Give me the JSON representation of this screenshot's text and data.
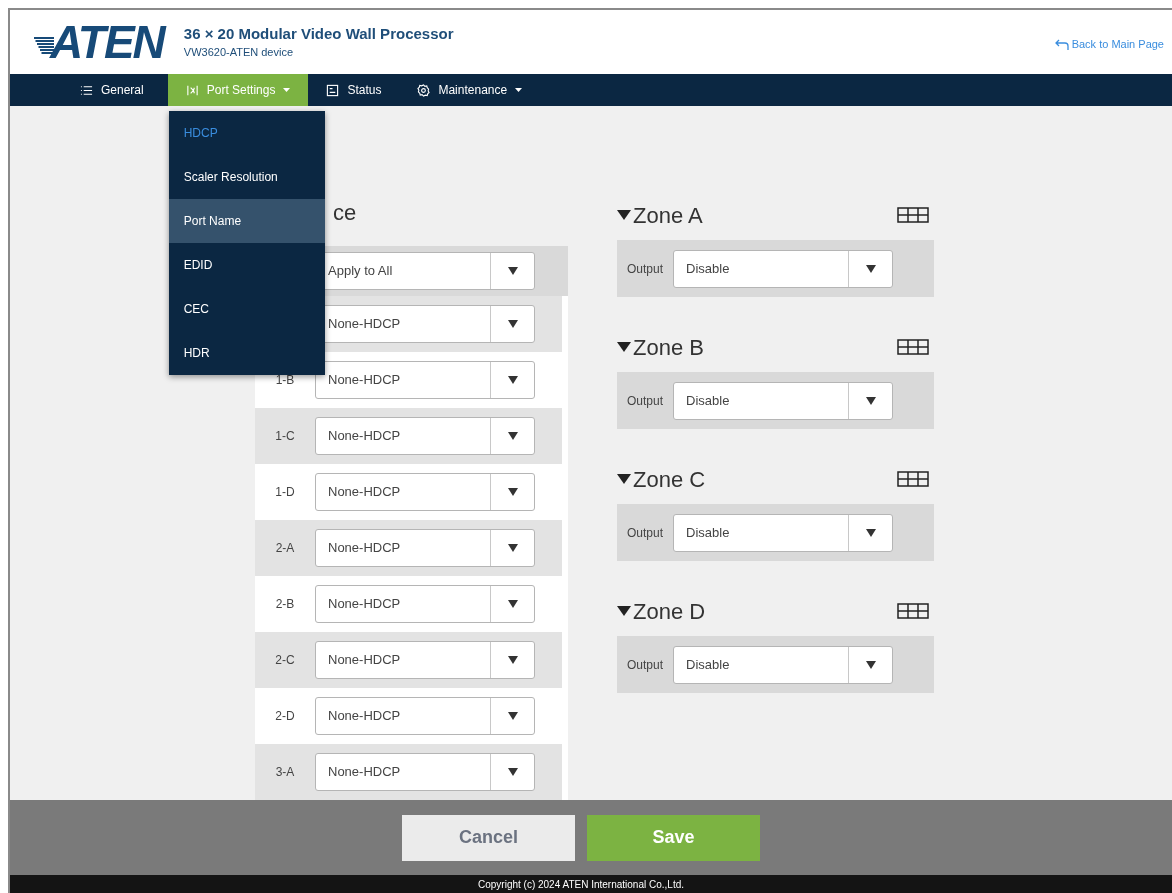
{
  "header": {
    "logo": "ATEN",
    "title": "36 × 20 Modular Video Wall Processor",
    "subtitle": "VW3620-ATEN device",
    "back_link": "Back to Main Page"
  },
  "nav": [
    {
      "label": "General",
      "selected": false,
      "dropdown": false
    },
    {
      "label": "Port Settings",
      "selected": true,
      "dropdown": true
    },
    {
      "label": "Status",
      "selected": false,
      "dropdown": false
    },
    {
      "label": "Maintenance",
      "selected": false,
      "dropdown": true
    }
  ],
  "dropdown_menu": [
    {
      "label": "HDCP",
      "selected": true,
      "highlighted": false
    },
    {
      "label": "Scaler Resolution",
      "selected": false,
      "highlighted": false
    },
    {
      "label": "Port Name",
      "selected": false,
      "highlighted": true
    },
    {
      "label": "EDID",
      "selected": false,
      "highlighted": false
    },
    {
      "label": "CEC",
      "selected": false,
      "highlighted": false
    },
    {
      "label": "HDR",
      "selected": false,
      "highlighted": false
    }
  ],
  "source_panel": {
    "heading": "ce",
    "apply_value": "Apply to All",
    "ports": [
      {
        "value": "None-HDCP"
      },
      {
        "label": "1-B",
        "value": "None-HDCP"
      },
      {
        "label": "1-C",
        "value": "None-HDCP"
      },
      {
        "label": "1-D",
        "value": "None-HDCP"
      },
      {
        "label": "2-A",
        "value": "None-HDCP"
      },
      {
        "label": "2-B",
        "value": "None-HDCP"
      },
      {
        "label": "2-C",
        "value": "None-HDCP"
      },
      {
        "label": "2-D",
        "value": "None-HDCP"
      },
      {
        "label": "3-A",
        "value": "None-HDCP"
      }
    ]
  },
  "zones": [
    {
      "title": "Zone A",
      "expanded": true,
      "output_label": "Output",
      "value": "Disable"
    },
    {
      "title": "Zone B",
      "expanded": true,
      "output_label": "Output",
      "value": "Disable"
    },
    {
      "title": "Zone C",
      "expanded": true,
      "output_label": "Output",
      "value": "Disable"
    },
    {
      "title": "Zone D",
      "expanded": true,
      "output_label": "Output",
      "value": "Disable"
    }
  ],
  "buttons": {
    "cancel": "Cancel",
    "save": "Save"
  },
  "footer": "Copyright (c) 2024 ATEN International Co.,Ltd."
}
